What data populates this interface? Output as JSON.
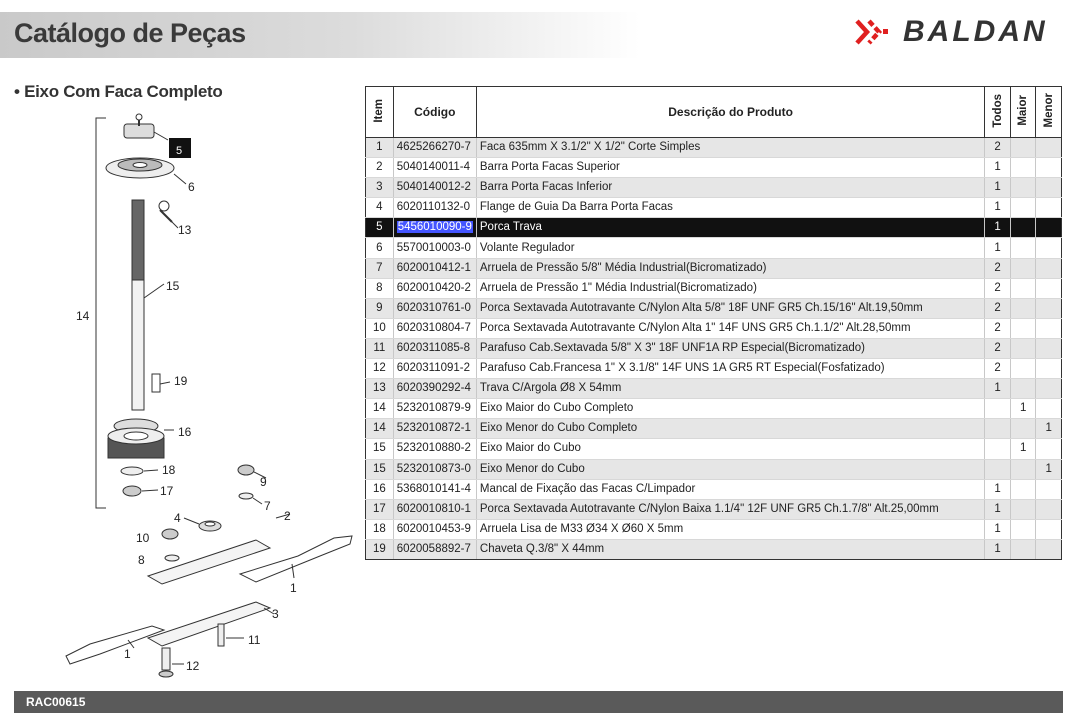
{
  "header": {
    "title": "Catálogo de Peças",
    "brand": "BALDAN"
  },
  "section": {
    "title": "• Eixo Com Faca Completo"
  },
  "diagram": {
    "callouts": [
      "5",
      "6",
      "13",
      "15",
      "14",
      "19",
      "16",
      "18",
      "17",
      "9",
      "7",
      "4",
      "2",
      "10",
      "8",
      "1",
      "3",
      "11",
      "1",
      "12"
    ]
  },
  "table": {
    "headers": {
      "item": "Item",
      "code": "Código",
      "description": "Descrição do Produto",
      "all": "Todos",
      "larger": "Maior",
      "smaller": "Menor"
    },
    "rows": [
      {
        "item": "1",
        "code": "4625266270-7",
        "desc": "Faca 635mm X 3.1/2\" X 1/2\" Corte Simples",
        "all": "2",
        "larger": "",
        "smaller": ""
      },
      {
        "item": "2",
        "code": "5040140011-4",
        "desc": "Barra Porta Facas Superior",
        "all": "1",
        "larger": "",
        "smaller": ""
      },
      {
        "item": "3",
        "code": "5040140012-2",
        "desc": "Barra Porta Facas Inferior",
        "all": "1",
        "larger": "",
        "smaller": ""
      },
      {
        "item": "4",
        "code": "6020110132-0",
        "desc": "Flange de Guia Da Barra Porta Facas",
        "all": "1",
        "larger": "",
        "smaller": ""
      },
      {
        "item": "5",
        "code": "5456010090-9",
        "desc": "Porca Trava",
        "all": "1",
        "larger": "",
        "smaller": ""
      },
      {
        "item": "6",
        "code": "5570010003-0",
        "desc": "Volante Regulador",
        "all": "1",
        "larger": "",
        "smaller": ""
      },
      {
        "item": "7",
        "code": "6020010412-1",
        "desc": "Arruela de Pressão 5/8\" Média Industrial(Bicromatizado)",
        "all": "2",
        "larger": "",
        "smaller": ""
      },
      {
        "item": "8",
        "code": "6020010420-2",
        "desc": "Arruela de Pressão 1\" Média Industrial(Bicromatizado)",
        "all": "2",
        "larger": "",
        "smaller": ""
      },
      {
        "item": "9",
        "code": "6020310761-0",
        "desc": "Porca Sextavada Autotravante C/Nylon Alta 5/8\" 18F UNF GR5 Ch.15/16\" Alt.19,50mm",
        "all": "2",
        "larger": "",
        "smaller": ""
      },
      {
        "item": "10",
        "code": "6020310804-7",
        "desc": "Porca Sextavada Autotravante C/Nylon Alta 1\" 14F UNS GR5 Ch.1.1/2\" Alt.28,50mm",
        "all": "2",
        "larger": "",
        "smaller": ""
      },
      {
        "item": "11",
        "code": "6020311085-8",
        "desc": "Parafuso Cab.Sextavada 5/8\" X 3\" 18F UNF1A RP Especial(Bicromatizado)",
        "all": "2",
        "larger": "",
        "smaller": ""
      },
      {
        "item": "12",
        "code": "6020311091-2",
        "desc": "Parafuso Cab.Francesa 1\" X 3.1/8\" 14F UNS 1A GR5 RT Especial(Fosfatizado)",
        "all": "2",
        "larger": "",
        "smaller": ""
      },
      {
        "item": "13",
        "code": "6020390292-4",
        "desc": "Trava C/Argola Ø8 X 54mm",
        "all": "1",
        "larger": "",
        "smaller": ""
      },
      {
        "item": "14",
        "code": "5232010879-9",
        "desc": "Eixo Maior do Cubo Completo",
        "all": "",
        "larger": "1",
        "smaller": ""
      },
      {
        "item": "14",
        "code": "5232010872-1",
        "desc": "Eixo Menor do Cubo Completo",
        "all": "",
        "larger": "",
        "smaller": "1"
      },
      {
        "item": "15",
        "code": "5232010880-2",
        "desc": "Eixo Maior do Cubo",
        "all": "",
        "larger": "1",
        "smaller": ""
      },
      {
        "item": "15",
        "code": "5232010873-0",
        "desc": "Eixo Menor do Cubo",
        "all": "",
        "larger": "",
        "smaller": "1"
      },
      {
        "item": "16",
        "code": "5368010141-4",
        "desc": "Mancal de Fixação das Facas C/Limpador",
        "all": "1",
        "larger": "",
        "smaller": ""
      },
      {
        "item": "17",
        "code": "6020010810-1",
        "desc": "Porca Sextavada Autotravante C/Nylon Baixa 1.1/4\" 12F UNF GR5 Ch.1.7/8\" Alt.25,00mm",
        "all": "1",
        "larger": "",
        "smaller": ""
      },
      {
        "item": "18",
        "code": "6020010453-9",
        "desc": "Arruela Lisa de M33 Ø34 X Ø60 X 5mm",
        "all": "1",
        "larger": "",
        "smaller": ""
      },
      {
        "item": "19",
        "code": "6020058892-7",
        "desc": "Chaveta Q.3/8\" X 44mm",
        "all": "1",
        "larger": "",
        "smaller": ""
      }
    ],
    "selected_index": 4
  },
  "footer": {
    "code": "RAC00615"
  },
  "colors": {
    "brand_red": "#e02020",
    "header_gray": "#d0d0d0",
    "footer_gray": "#5a5a5a",
    "selection": "#111111",
    "code_highlight": "#4455ff"
  }
}
